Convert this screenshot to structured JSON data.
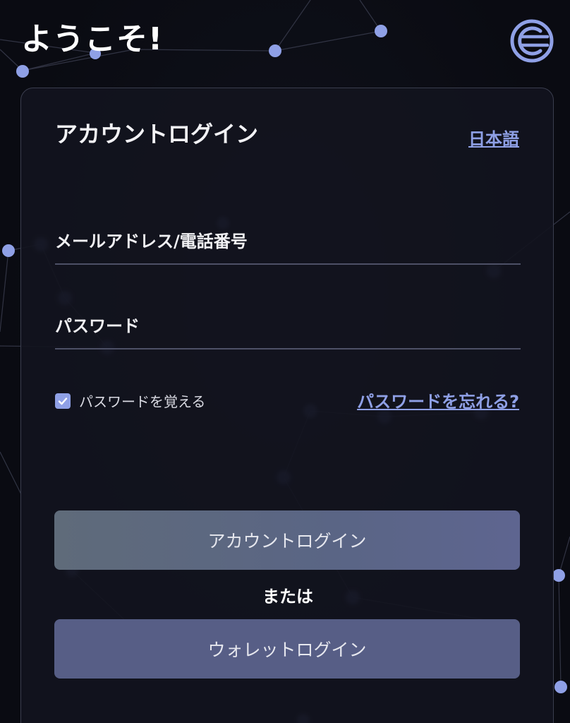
{
  "header": {
    "welcome": "ようこそ!",
    "logo_icon": "brand-logo-icon"
  },
  "card": {
    "title": "アカウントログイン",
    "language_link": "日本語",
    "email_field": {
      "placeholder": "メールアドレス/電話番号",
      "value": ""
    },
    "password_field": {
      "placeholder": "パスワード",
      "value": ""
    },
    "remember": {
      "label": "パスワードを覚える",
      "checked": true
    },
    "forgot_link": "パスワードを忘れる?",
    "account_login_button": "アカウントログイン",
    "or_text": "または",
    "wallet_login_button": "ウォレットログイン"
  },
  "colors": {
    "background": "#0c0d14",
    "card_background": "#12141e",
    "accent_link": "#8fa0e6",
    "network_node": "#8fa0e6",
    "primary_button": "#5a6585",
    "wallet_button": "#575e86"
  }
}
